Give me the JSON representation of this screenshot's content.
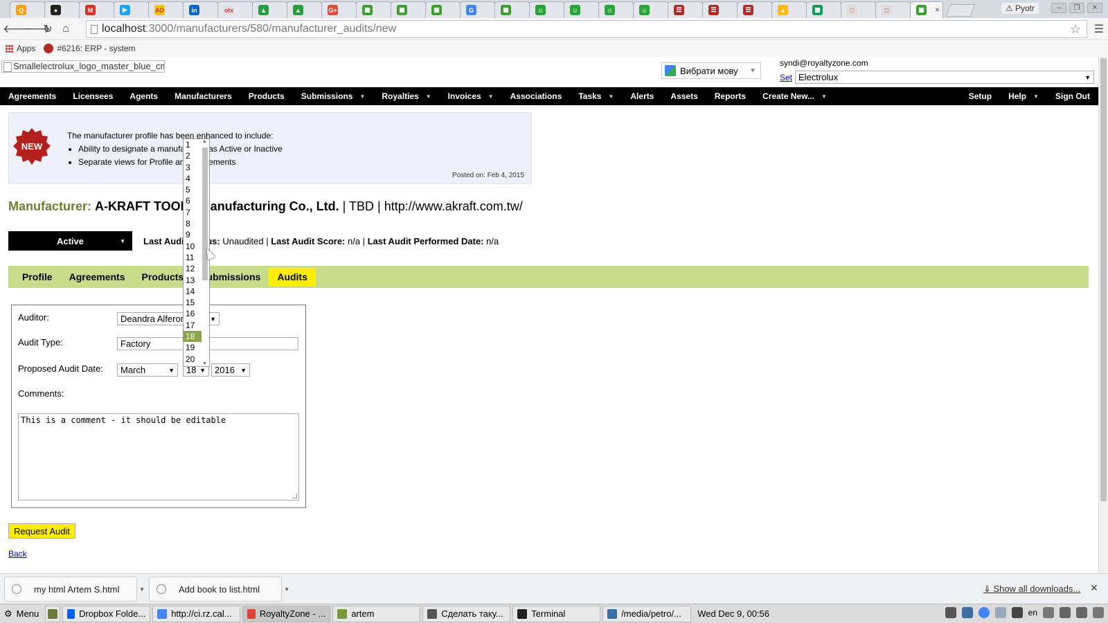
{
  "browser": {
    "tabs": [
      {
        "letter": "Q",
        "color": "#f4a300"
      },
      {
        "letter": "●",
        "color": "#222222"
      },
      {
        "letter": "M",
        "color": "#d93025"
      },
      {
        "letter": "▶",
        "color": "#1da1f2"
      },
      {
        "letter": "AD",
        "color": "#f5c400"
      },
      {
        "letter": "in",
        "color": "#0a66c2"
      },
      {
        "letter": "olx",
        "color": "#e4e4e4"
      },
      {
        "letter": "▲",
        "color": "#2a9d3f"
      },
      {
        "letter": "▲",
        "color": "#2a9d3f"
      },
      {
        "letter": "G+",
        "color": "#dd4b39"
      },
      {
        "letter": "▣",
        "color": "#3f9c35"
      },
      {
        "letter": "▣",
        "color": "#3f9c35"
      },
      {
        "letter": "▣",
        "color": "#3f9c35"
      },
      {
        "letter": "G",
        "color": "#4285f4"
      },
      {
        "letter": "▣",
        "color": "#3f9c35"
      },
      {
        "letter": "☺",
        "color": "#2aa43a"
      },
      {
        "letter": "☺",
        "color": "#2aa43a"
      },
      {
        "letter": "☺",
        "color": "#2aa43a"
      },
      {
        "letter": "☺",
        "color": "#2aa43a"
      },
      {
        "letter": "☰",
        "color": "#b02a2a"
      },
      {
        "letter": "☰",
        "color": "#b02a2a"
      },
      {
        "letter": "☰",
        "color": "#b02a2a"
      },
      {
        "letter": "▲",
        "color": "#fbbc04"
      },
      {
        "letter": "▦",
        "color": "#0f9d58"
      },
      {
        "letter": "□",
        "color": "#dddddd"
      },
      {
        "letter": "□",
        "color": "#dddddd"
      }
    ],
    "active_tab_icon": "▣",
    "user_name": "Pyotr",
    "url_host": "localhost",
    "url_path": ":3000/manufacturers/580/manufacturer_audits/new",
    "bookmarks": {
      "apps_label": "Apps",
      "item_label": "#6216: ERP - system"
    }
  },
  "header": {
    "logo_alt": "Smallelectrolux_logo_master_blue_cmyk",
    "translate_label": "Вибрати мову",
    "user_email": "syndi@royaltyzone.com",
    "set_label": "Set",
    "company": "Electrolux"
  },
  "nav": {
    "left": [
      {
        "label": "Agreements",
        "caret": false
      },
      {
        "label": "Licensees",
        "caret": false
      },
      {
        "label": "Agents",
        "caret": false
      },
      {
        "label": "Manufacturers",
        "caret": false
      },
      {
        "label": "Products",
        "caret": false
      },
      {
        "label": "Submissions",
        "caret": true
      },
      {
        "label": "Royalties",
        "caret": true
      },
      {
        "label": "Invoices",
        "caret": true
      },
      {
        "label": "Associations",
        "caret": false
      },
      {
        "label": "Tasks",
        "caret": true
      },
      {
        "label": "Alerts",
        "caret": false
      },
      {
        "label": "Assets",
        "caret": false
      },
      {
        "label": "Reports",
        "caret": false
      },
      {
        "label": "Create New...",
        "caret": true
      }
    ],
    "right": [
      {
        "label": "Setup",
        "caret": false
      },
      {
        "label": "Help",
        "caret": true
      },
      {
        "label": "Sign Out",
        "caret": false
      }
    ]
  },
  "notice": {
    "badge": "NEW",
    "intro": "The manufacturer profile has been enhanced to include:",
    "bullets": [
      "Ability to designate a manufacturer as Active or Inactive",
      "Separate views for Profile and Agreements"
    ],
    "posted": "Posted on: Feb 4, 2015"
  },
  "manufacturer": {
    "label": "Manufacturer:",
    "name": "A-KRAFT TOOLS Manufacturing Co., Ltd.",
    "rest": " | TBD | http://www.akraft.com.tw/",
    "status": "Active",
    "audit_status_label": "Last Audit Status:",
    "audit_status": " Unaudited | ",
    "audit_score_label": "Last Audit Score:",
    "audit_score": " n/a | ",
    "audit_date_label": "Last Audit Performed Date:",
    "audit_date": " n/a"
  },
  "subnav": {
    "tabs": [
      "Profile",
      "Agreements",
      "Products",
      "Submissions",
      "Audits"
    ],
    "active": "Audits"
  },
  "form": {
    "auditor_label": "Auditor:",
    "auditor_value": "Deandra Alferon",
    "type_label": "Audit Type:",
    "type_value": "Factory",
    "date_label": "Proposed Audit Date:",
    "month": "March",
    "day": "18",
    "year": "2016",
    "comments_label": "Comments:",
    "comments_value": "This is a comment - it should be editable",
    "submit_label": "Request Audit",
    "back_label": "Back"
  },
  "day_dropdown": {
    "options": [
      "1",
      "2",
      "3",
      "4",
      "5",
      "6",
      "7",
      "8",
      "9",
      "10",
      "11",
      "12",
      "13",
      "14",
      "15",
      "16",
      "17",
      "18",
      "19",
      "20"
    ],
    "selected": "18"
  },
  "downloads": {
    "items": [
      "my html Artem S.html",
      "Add book to list.html"
    ],
    "show_all": "Show all downloads..."
  },
  "taskbar": {
    "menu_label": "Menu",
    "items": [
      {
        "label": "Dropbox Folde...",
        "color": "#0061fe"
      },
      {
        "label": "http://ci.rz.cal...",
        "color": "#4285f4"
      },
      {
        "label": "RoyaltyZone - ...",
        "color": "#db4437"
      },
      {
        "label": "artem",
        "color": "#7a9a3a"
      },
      {
        "label": "Сделать таку...",
        "color": "#555555"
      },
      {
        "label": "Terminal",
        "color": "#222222"
      },
      {
        "label": "/media/petro/...",
        "color": "#3a6ea5"
      }
    ],
    "clock": "Wed Dec  9, 00:56",
    "lang": "en"
  },
  "colors": {
    "nav_bg": "#000000",
    "subnav_bg": "#c8dc8b",
    "active_highlight": "#ffee00",
    "label_green": "#6b7f32",
    "selected_option": "#8fa54d"
  }
}
